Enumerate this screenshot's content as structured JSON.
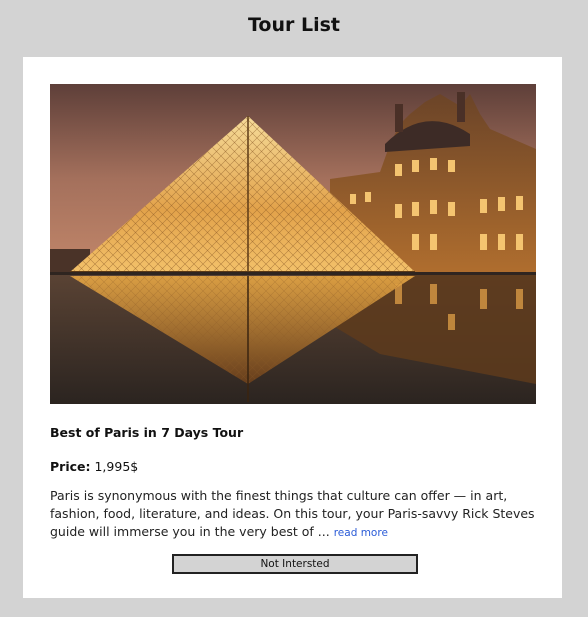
{
  "page": {
    "title": "Tour List"
  },
  "tour": {
    "image_alt": "Louvre pyramid at dusk",
    "name": "Best of Paris in 7 Days Tour",
    "price_label": "Price:",
    "price_value": "1,995$",
    "description": "Paris is synonymous with the finest things that culture can offer — in art, fashion, food, literature, and ideas. On this tour, your Paris-savvy Rick Steves guide will immerse you in the very best of ...",
    "read_more_label": "read more",
    "not_interested_label": "Not Intersted"
  }
}
